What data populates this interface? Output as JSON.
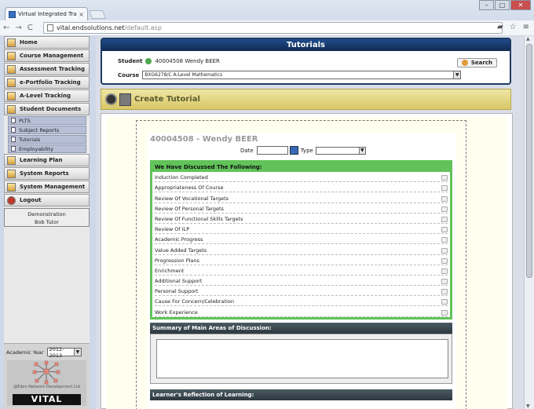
{
  "browser": {
    "tab_title": "Virtual Integrated Tracking",
    "url_host": "vital.endsolutions.net",
    "url_path": "/default.asp"
  },
  "sidebar": {
    "items": [
      {
        "label": "Home"
      },
      {
        "label": "Course Management"
      },
      {
        "label": "Assessment Tracking"
      },
      {
        "label": "e-Portfolio Tracking"
      },
      {
        "label": "A-Level Tracking"
      },
      {
        "label": "Student Documents"
      }
    ],
    "sub_items": [
      {
        "label": "PLTS"
      },
      {
        "label": "Subject Reports"
      },
      {
        "label": "Tutorials"
      },
      {
        "label": "Employability"
      }
    ],
    "items_after": [
      {
        "label": "Learning Plan"
      },
      {
        "label": "System Reports"
      },
      {
        "label": "System Management"
      },
      {
        "label": "Logout"
      }
    ],
    "user": {
      "line1": "Demonstration",
      "line2": "Bob Tutor"
    },
    "academic_year": {
      "label": "Academic Year",
      "value": "2012-2013"
    },
    "logo": {
      "org": "@Eden Network Development Ltd",
      "brand": "VITAL"
    }
  },
  "header": {
    "title": "Tutorials",
    "student_label": "Student",
    "student_value": "40004508 Wendy BEER",
    "course_label": "Course",
    "course_value": "BXG6278/C A-Level Mathematics",
    "search_label": "Search"
  },
  "action": {
    "title": "Create Tutorial"
  },
  "form": {
    "title": "40004508 - Wendy BEER",
    "date_label": "Date",
    "type_label": "Type",
    "discussed_heading": "We Have Discussed The Following:",
    "topics": [
      "Induction Completed",
      "Appropriateness Of Course",
      "Review Of Vocational Targets",
      "Review Of Personal Targets",
      "Review Of Functional Skills Targets",
      "Review Of ILP",
      "Academic Progress",
      "Value Added Targets",
      "Progression Plans",
      "Enrichment",
      "Additional Support",
      "Personal Support",
      "Cause For Concern/Celebration",
      "Work Experience"
    ],
    "summary_heading": "Summary of Main Areas of Discussion:",
    "reflection_heading": "Learner's Reflection of Learning:"
  }
}
